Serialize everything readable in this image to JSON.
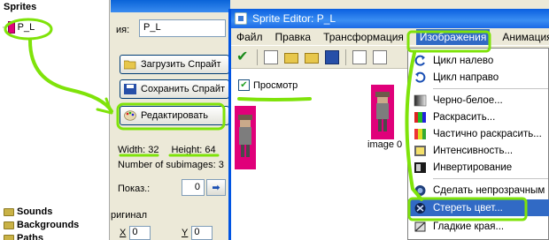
{
  "tree": {
    "sprites_label": "Sprites",
    "sprite_item": "P_L",
    "sounds_label": "Sounds",
    "backgrounds_label": "Backgrounds",
    "paths_label": "Paths"
  },
  "props": {
    "name_label": "ия:",
    "name_value": "P_L",
    "load_button": "Загрузить Спрайт",
    "save_button": "Сохранить Спрайт",
    "edit_button": "Редактировать",
    "width_label": "Width: 32",
    "height_label": "Height: 64",
    "subimages": "Number of subimages: 3",
    "show_label": "Показ.:",
    "show_value": "0",
    "origin_label": "ригинал",
    "x_label": "X",
    "x_value": "0",
    "y_label": "Y",
    "y_value": "0"
  },
  "editor": {
    "title": "Sprite Editor: P_L",
    "menu": [
      "Файл",
      "Правка",
      "Трансформация",
      "Изображения",
      "Анимация"
    ],
    "preview_label": "Просмотр",
    "image_label": "image 0"
  },
  "dropdown": {
    "items": [
      "Цикл налево",
      "Цикл направо",
      "Черно-белое...",
      "Раскрасить...",
      "Частично раскрасить...",
      "Интенсивность...",
      "Инвертирование",
      "Сделать непрозрачным",
      "Стереть цвет...",
      "Гладкие края..."
    ],
    "highlighted_index": 8
  },
  "colors": {
    "highlight_stroke": "#7fe30a",
    "menu_select": "#316ac5",
    "sprite_bg": "#e0007a",
    "titlebar": "#0a5fe0"
  }
}
